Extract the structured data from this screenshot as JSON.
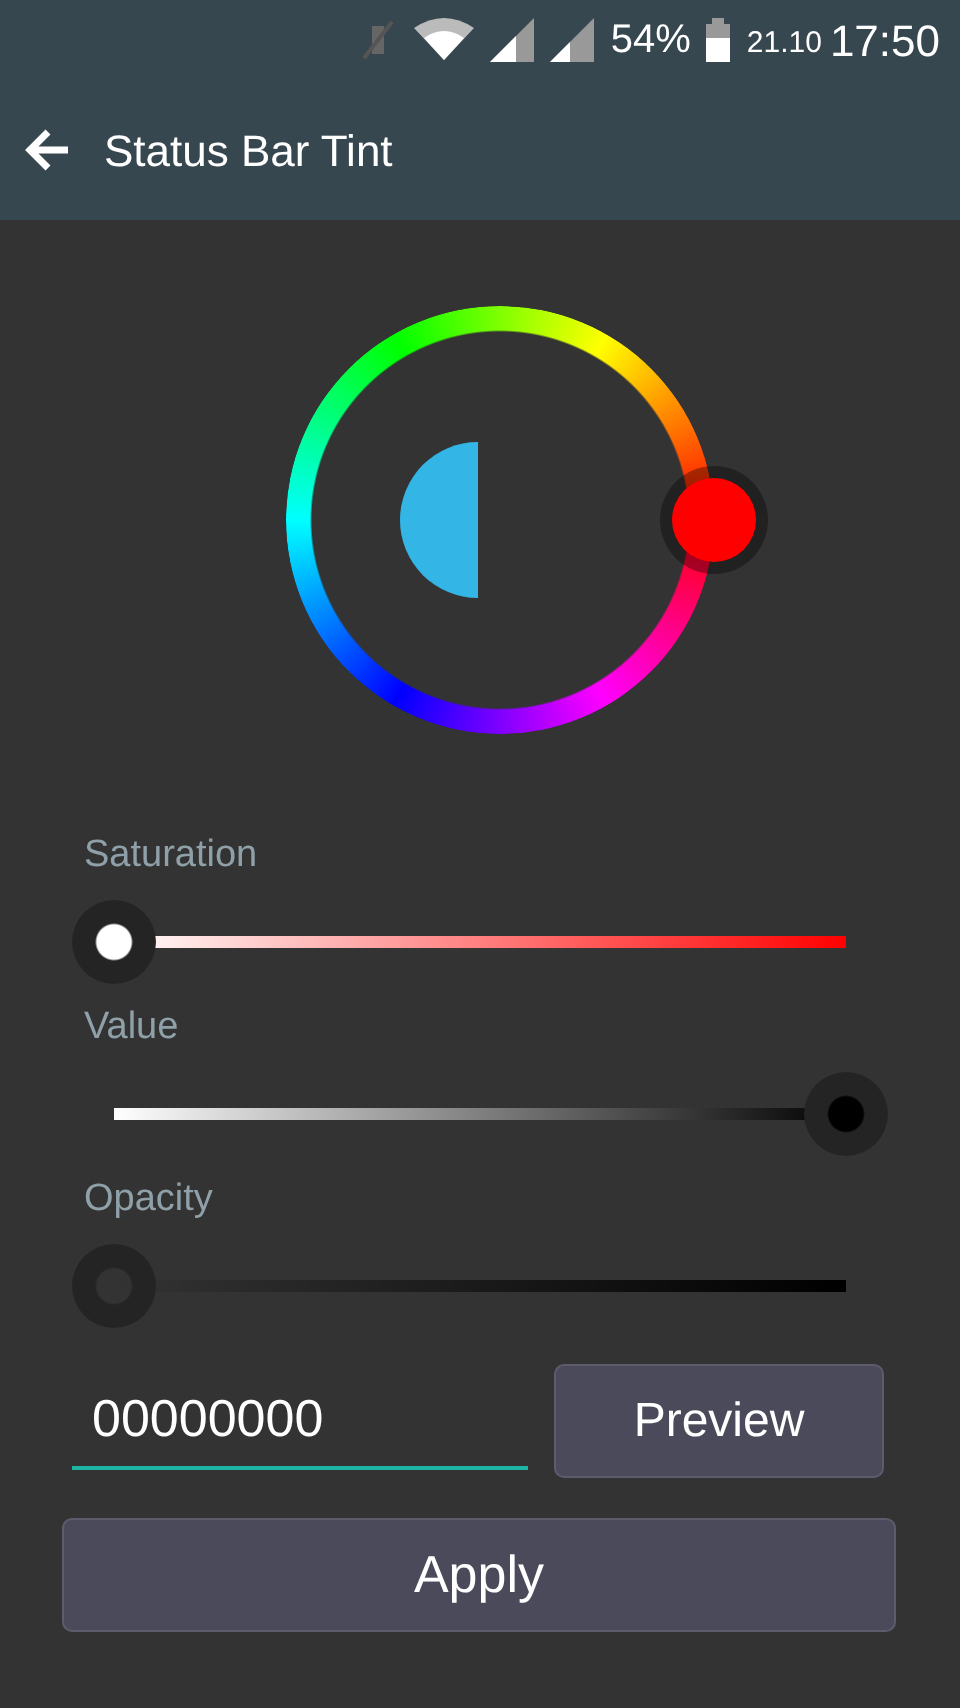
{
  "status_bar": {
    "battery": "54%",
    "date": "21.10",
    "time": "17:50"
  },
  "app_bar": {
    "title": "Status Bar Tint"
  },
  "sliders": [
    {
      "kind": "saturation",
      "label": "Saturation",
      "level": 0
    },
    {
      "kind": "value",
      "label": "Value",
      "level": 1
    },
    {
      "kind": "opacity",
      "label": "Opacity",
      "level": 0
    }
  ],
  "color_field": {
    "value": "00000000"
  },
  "buttons": {
    "preview": "Preview",
    "apply": "Apply"
  }
}
